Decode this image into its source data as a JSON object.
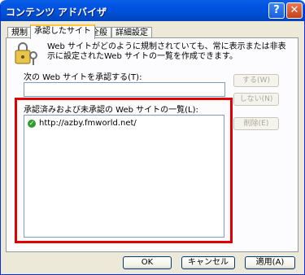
{
  "window": {
    "title": "コンテンツ アドバイザ"
  },
  "tabs": [
    {
      "label": "規制"
    },
    {
      "label": "承認したサイト"
    },
    {
      "label": "全般"
    },
    {
      "label": "詳細設定"
    }
  ],
  "description": "Web サイトがどのように規制されていても、常に表示または非表示に設定されたWeb サイトの一覧を作成できます。",
  "approve_label": "次の Web サイトを承認する(T):",
  "approve_input_value": "",
  "side_buttons": {
    "always": "する(W)",
    "never": "しない(N)",
    "remove": "削除(E)"
  },
  "list_label": "承認済みおよび未承認の Web サイトの一覧(L):",
  "sites": [
    {
      "url": "http://azby.fmworld.net/",
      "status_icon": "approved-check-icon"
    }
  ],
  "buttons": {
    "ok": "OK",
    "cancel": "キャンセル",
    "apply": "適用(A)"
  },
  "colors": {
    "highlight": "#e00000",
    "titlebar": "#0053e1"
  }
}
